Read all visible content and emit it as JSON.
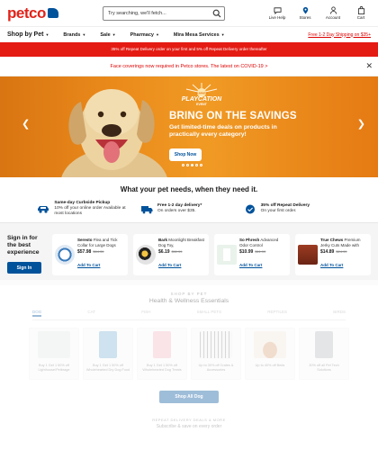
{
  "header": {
    "logo": "petco",
    "search_placeholder": "Try searching, we'll fetch...",
    "icons": [
      {
        "label": "Live Help",
        "icon": "chat-icon"
      },
      {
        "label": "Stores",
        "icon": "location-pin-icon"
      },
      {
        "label": "Account",
        "icon": "person-icon"
      },
      {
        "label": "Cart",
        "icon": "bag-icon"
      }
    ]
  },
  "nav": {
    "shop_by_pet": "Shop by Pet",
    "items": [
      "Brands",
      "Sale",
      "Pharmacy",
      "Mira Mesa Services"
    ],
    "free_shipping": "Free 1-2 Day Shipping on $35+"
  },
  "promo_bar": "35% off Repeat Delivery order on your first and 5% off Repeat Delivery order thereafter",
  "covid_notice": "Face coverings now required in Petco stores. The latest on COVID-19 >",
  "hero": {
    "badge_top": "SUMMER",
    "badge_main": "PLAYCATION",
    "badge_sub": "EVENT",
    "headline": "BRING ON THE SAVINGS",
    "subhead": "Get limited-time deals on products in practically every category!",
    "cta": "Shop Now",
    "slide_count": 5,
    "active_slide": 2,
    "colors": {
      "bg": "#ea8a1b",
      "cta_text": "#00529b"
    }
  },
  "needs_heading": "What your pet needs, when they need it.",
  "services": [
    {
      "title": "Same-day Curbside Pickup",
      "desc": "10% off your online order Available at most locations"
    },
    {
      "title": "Free 1-2 day delivery*",
      "desc": "On orders over $35."
    },
    {
      "title": "35% off Repeat Delivery",
      "desc": "On your first order."
    }
  ],
  "signin": {
    "text": "Sign in for the best experience",
    "button": "Sign In"
  },
  "products": [
    {
      "brand": "Seresto",
      "name": "Flea and Tick Collar for Large Dogs",
      "price": "$57.98",
      "was": "$64.39",
      "atc": "Add To Cart"
    },
    {
      "brand": "Bark",
      "name": "Moonlight Breakfast Dog Toy,",
      "price": "$6.19",
      "was": "$11.99",
      "atc": "Add To Cart"
    },
    {
      "brand": "So Phresh",
      "name": "Advanced Odor Control",
      "price": "$10.99",
      "was": "$11.99",
      "atc": "Add To Cart"
    },
    {
      "brand": "True Chews",
      "name": "Premium Jerky Cuts Made with",
      "price": "$14.89",
      "was": "$24.99",
      "atc": "Add To Cart"
    }
  ],
  "shop_by_pet": {
    "kicker": "SHOP BY PET",
    "heading": "Health & Wellness Essentials",
    "tabs": [
      "DOG",
      "CAT",
      "FISH",
      "SMALL PETS",
      "REPTILES",
      "BIRDS"
    ],
    "active_tab": 0,
    "cards": [
      {
        "caption": "Buy 1 Get 1 50% off Lighthouse/Petbrage"
      },
      {
        "caption": "Buy 1 Get 1 50% off Wholehearted Dry Dog Food"
      },
      {
        "caption": "Buy 1 Get 1 50% off Wholehearted Dog Treats"
      },
      {
        "caption": "Up to 30% off Crates & Accessories"
      },
      {
        "caption": "Up to 40% off Beds"
      },
      {
        "caption": "30% off all Pet Tech Solutions"
      }
    ],
    "shop_all": "Shop All Dog"
  },
  "footer": {
    "line1": "REPEAT DELIVERY DEALS & MORE",
    "line2": "Subscribe & save on every order"
  }
}
